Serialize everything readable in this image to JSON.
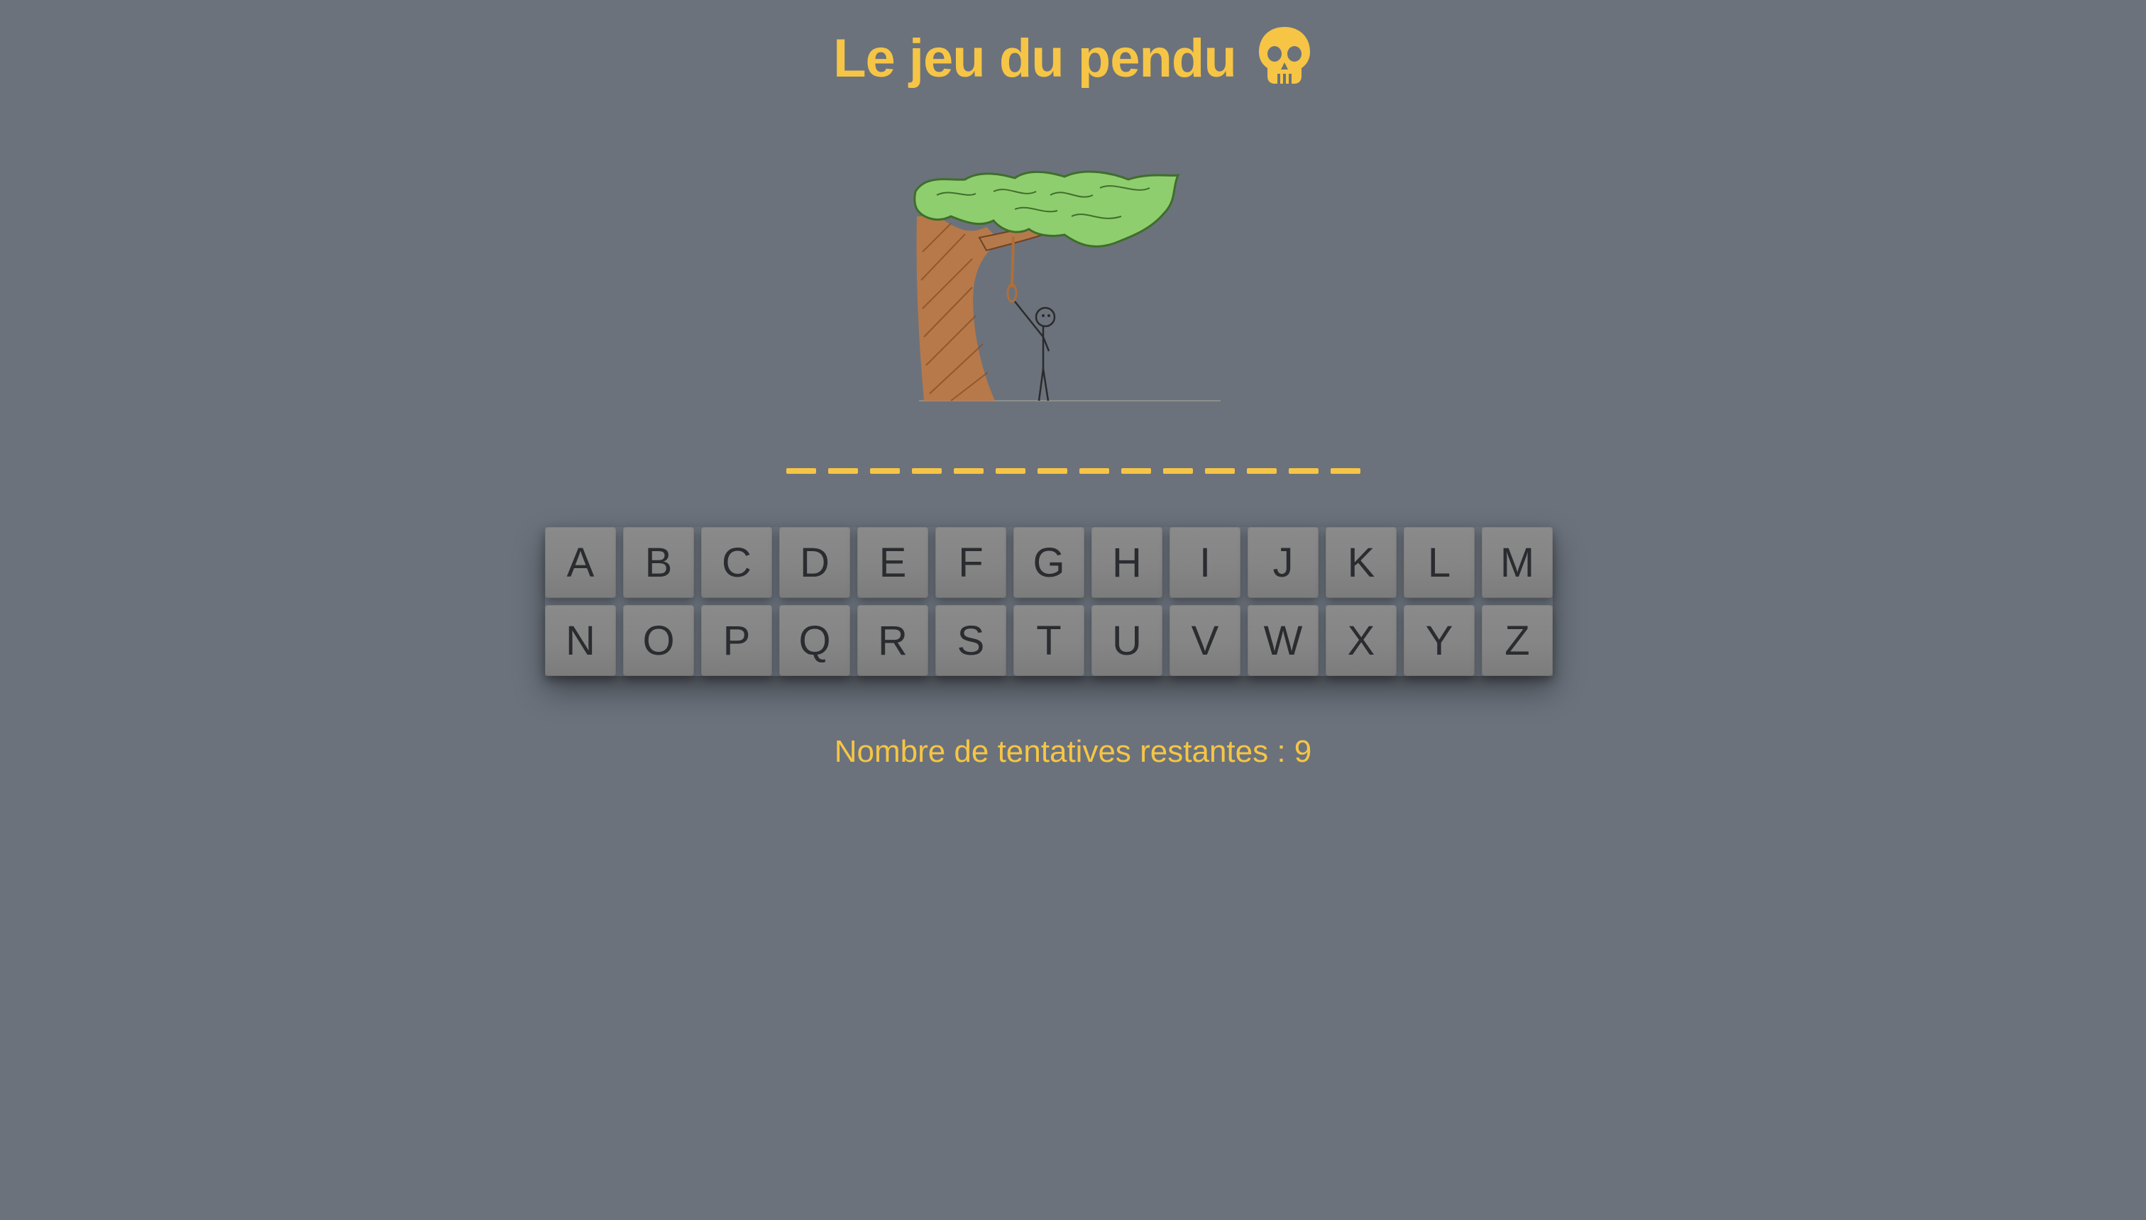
{
  "header": {
    "title": "Le jeu du pendu",
    "emoji_icon": "skull-icon"
  },
  "word": {
    "hidden_letters": 14,
    "slot_color": "#f6c545"
  },
  "keyboard": {
    "letters": [
      "A",
      "B",
      "C",
      "D",
      "E",
      "F",
      "G",
      "H",
      "I",
      "J",
      "K",
      "L",
      "M",
      "N",
      "O",
      "P",
      "Q",
      "R",
      "S",
      "T",
      "U",
      "V",
      "W",
      "X",
      "Y",
      "Z"
    ]
  },
  "status": {
    "attempts_label": "Nombre de tentatives restantes : 9"
  },
  "colors": {
    "background": "#6b727c",
    "accent": "#f6c545",
    "key": "#858585"
  }
}
